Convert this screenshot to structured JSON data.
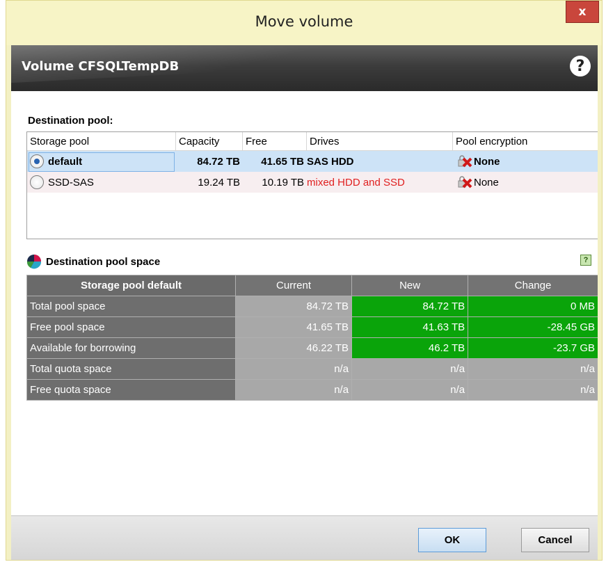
{
  "window": {
    "title": "Move volume",
    "close_label": "x"
  },
  "banner": {
    "title": "Volume CFSQLTempDB",
    "help_label": "?"
  },
  "destination_pool": {
    "label": "Destination pool:",
    "columns": [
      "Storage pool",
      "Capacity",
      "Free",
      "Drives",
      "Pool encryption"
    ],
    "rows": [
      {
        "name": "default",
        "capacity": "84.72 TB",
        "free": "41.65 TB",
        "drives": "SAS HDD",
        "encryption": "None",
        "selected": true
      },
      {
        "name": "SSD-SAS",
        "capacity": "19.24 TB",
        "free": "10.19 TB",
        "drives": "mixed HDD and SSD",
        "encryption": "None",
        "selected": false
      }
    ]
  },
  "pool_space": {
    "label": "Destination pool space",
    "help_label": "?",
    "columns": [
      "Storage pool default",
      "Current",
      "New",
      "Change"
    ],
    "rows": [
      {
        "label": "Total pool space",
        "current": "84.72 TB",
        "new": "84.72 TB",
        "change": "0 MB"
      },
      {
        "label": "Free pool space",
        "current": "41.65 TB",
        "new": "41.63 TB",
        "change": "-28.45 GB"
      },
      {
        "label": "Available for borrowing",
        "current": "46.22 TB",
        "new": "46.2 TB",
        "change": "-23.7 GB"
      },
      {
        "label": "Total quota space",
        "current": "n/a",
        "new": "n/a",
        "change": "n/a"
      },
      {
        "label": "Free quota space",
        "current": "n/a",
        "new": "n/a",
        "change": "n/a"
      }
    ]
  },
  "footer": {
    "ok_label": "OK",
    "cancel_label": "Cancel"
  },
  "colors": {
    "title_bg": "#f7f4c6",
    "close_red": "#c9463c",
    "selected_row": "#cde3f7",
    "green_cell": "#0aa40a",
    "drives_warning": "#e02020"
  }
}
